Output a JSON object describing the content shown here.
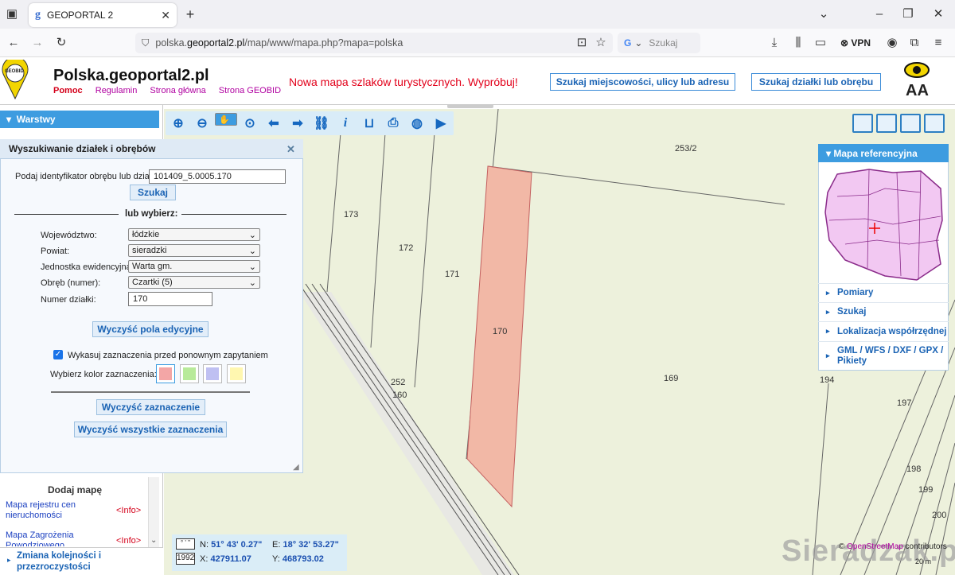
{
  "browser": {
    "tab_title": "GEOPORTAL 2",
    "url_domain": "polska.",
    "url_host": "geoportal2.pl",
    "url_path": "/map/www/mapa.php?mapa=polska",
    "search_placeholder": "Szukaj",
    "vpn_label": "VPN"
  },
  "header": {
    "logo_text": "GEOBID",
    "site_title": "Polska.geoportal2.pl",
    "links": [
      "Pomoc",
      "Regulamin",
      "Strona główna",
      "Strona GEOBID"
    ],
    "promo": "Nowa mapa szlaków turystycznych. Wypróbuj!",
    "btn_address": "Szukaj miejscowości, ulicy lub adresu",
    "btn_parcel": "Szukaj działki lub obrębu",
    "font_toggle": "AA"
  },
  "left": {
    "layers_header": "Warstwy",
    "add_map_title": "Dodaj mapę",
    "maps": [
      {
        "name": "Mapa rejestru cen nieruchomości",
        "info": "<Info>"
      },
      {
        "name": "Mapa Zagrożenia Powodziowego",
        "info": "<Info>"
      }
    ],
    "footer": "Zmiana kolejności i przezroczystości"
  },
  "dialog": {
    "title": "Wyszukiwanie działek i obrębów",
    "id_label": "Podaj identyfikator obrębu lub działki:",
    "id_value": "101409_5.0005.170",
    "search_btn": "Szukaj",
    "or_choose": "lub wybierz:",
    "fields": [
      {
        "label": "Województwo:",
        "value": "łódzkie"
      },
      {
        "label": "Powiat:",
        "value": "sieradzki"
      },
      {
        "label": "Jednostka ewidencyjna:",
        "value": "Warta gm."
      },
      {
        "label": "Obręb (numer):",
        "value": "Czartki (5)"
      }
    ],
    "parcel_label": "Numer działki:",
    "parcel_value": "170",
    "clear_fields": "Wyczyść pola edycyjne",
    "checkbox_label": "Wykasuj zaznaczenia przed ponownym zapytaniem",
    "color_label": "Wybierz kolor zaznaczenia:",
    "colors": [
      "#f3a6a6",
      "#b8ea9a",
      "#bfc0f2",
      "#fff7b0"
    ],
    "clear_selection": "Wyczyść zaznaczenie",
    "clear_all": "Wyczyść wszystkie zaznaczenia"
  },
  "map": {
    "parcels": [
      "253/2",
      "173",
      "172",
      "171",
      "170",
      "169",
      "252",
      "160",
      "194",
      "197",
      "198",
      "199",
      "200"
    ],
    "coords": {
      "fmt1": "° ' \"",
      "n_label": "N:",
      "n_value": "51° 43' 0.27\"",
      "e_label": "E:",
      "e_value": "18° 32' 53.27\"",
      "fmt2": "1992",
      "x_label": "X:",
      "x_value": "427911.07",
      "y_label": "Y:",
      "y_value": "468793.02"
    },
    "attribution_prefix": "©",
    "attribution_link": "OpenStreetMap",
    "attribution_suffix": "contributors",
    "scale": "20 m",
    "watermark": "Sieradzak.pl"
  },
  "right": {
    "ref_map": "Mapa referencyjna",
    "items": [
      "Pomiary",
      "Szukaj",
      "Lokalizacja współrzędnej",
      "GML / WFS / DXF / GPX / Pikiety"
    ]
  },
  "colors": {
    "accent": "#3d9ce0",
    "highlight": "#f3b9a6"
  }
}
